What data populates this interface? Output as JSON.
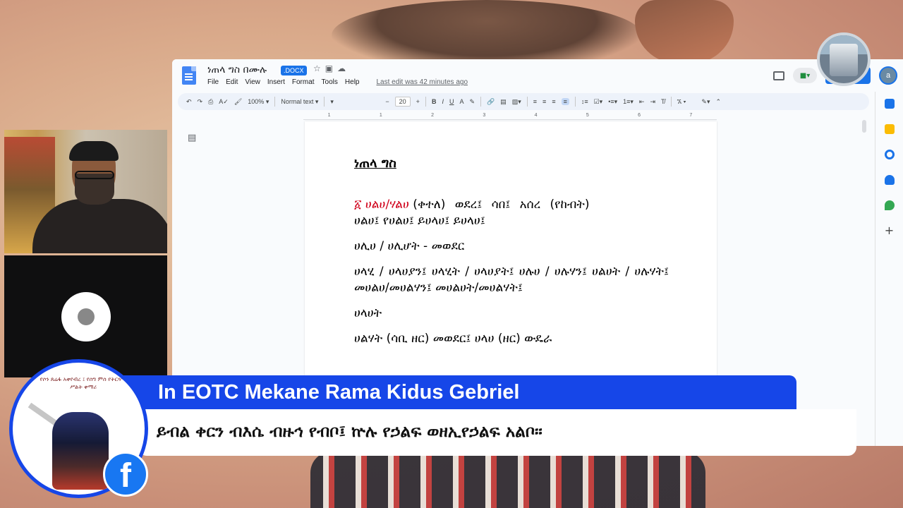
{
  "docs": {
    "title": "ነጠላ ግስ በሙሉ",
    "extension": ".DOCX",
    "menu": [
      "File",
      "Edit",
      "View",
      "Insert",
      "Format",
      "Tools",
      "Help"
    ],
    "last_edit": "Last edit was 42 minutes ago",
    "account_initial": "a",
    "toolbar": {
      "zoom": "100%",
      "style": "Normal text",
      "font_size": "20"
    },
    "ruler_marks": [
      "1",
      "1",
      "2",
      "3",
      "4",
      "5",
      "6",
      "7"
    ],
    "content": {
      "heading": "ነጠላ ግስ",
      "line1_number": "፩",
      "line1_red": "ሀልሀ/ሃልሀ",
      "line1_rest": "(ቀተለ) ወደረ፤ ሳበ፤ አሰረ (የከብት)",
      "line2": "ሀልሀ፤ የሀልሀ፤ ይሀላሀ፤ ይሀላሀ፤",
      "line3": "ሀሊሀ / ሀሊሆት - መወደር",
      "line4": "ሀላሂ / ሀላሀያን፤ ሀላሂት / ሀላሀያት፤ ሀሉሀ / ሀሉሃን፤ ሀልሀት / ሀሉሃት፤ መሀልሀ/መሀልሃን፤ መሀልሀት/መሀልሃት፤",
      "line5": "ሀላሀት",
      "line6": "ሀልሃት (ሳቢ ዘር) መወደር፤ ሀላሀ (ዘር) ውዴራ"
    }
  },
  "banner": {
    "title": "In EOTC Mekane Rama Kidus Gebriel",
    "subtitle": "ይብል ቀርን ብእሴ ብዙኅ የብቦ፤  ኵሉ የኃልፍ ወዘኢየኃልፍ አልቦ።",
    "logo_text": "የሶን ጸሬፋ አቀየብረ ፤ የሰግ ምሰ የትርጓሜ ሥልት ቀማሪ",
    "facebook_letter": "f"
  },
  "colors": {
    "banner_blue": "#1646e8",
    "docs_blue": "#1a73e8",
    "red_text": "#d0021b"
  }
}
